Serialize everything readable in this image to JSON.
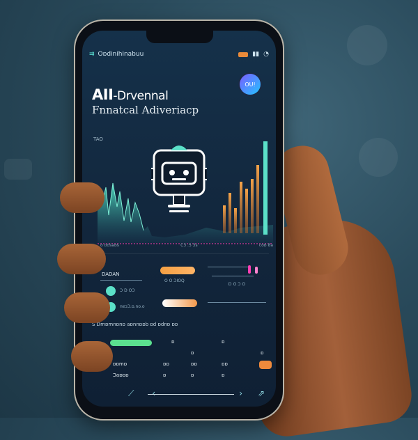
{
  "status_bar": {
    "app_name": "Oɒdinihinabuu",
    "icons": [
      "battery-icon",
      "signal-icon",
      "wifi-icon"
    ]
  },
  "avatar": {
    "label": "OU!"
  },
  "hero": {
    "title_bold": "AII",
    "title_rest": "-Drvennal",
    "subtitle": "Fnnatcal Adiveriacp"
  },
  "chart": {
    "top_label": "TAO",
    "axis_labels": [
      "o ɒdsaɒs",
      "C3 .5 3s",
      "coɒ 8a"
    ]
  },
  "controls": {
    "label_1": "DADAN",
    "slider_1_caption": "O O ƆIOQ",
    "toggle_1_caption": "Ɔ D OƆ",
    "toggle_2_caption": "nɐɔƆ.ɒ.no.o",
    "bar_1_caption": "Ɒ O Ɔ O"
  },
  "table": {
    "header": "S  Ɒmɒmnɒnɒ  aɒnnɒɒb  ɒd  ɒdnɒ  ɒɒ",
    "rows": [
      {
        "c1": "",
        "c2": "ɒ",
        "c3": "ɒ",
        "c4": "ɒ",
        "c5": ""
      },
      {
        "c1": "ɒɒb",
        "c2": "ɒ",
        "c3": "ɒ",
        "c4": "ɒ",
        "c5": "ɒ"
      },
      {
        "c1": "ɒɒmɒ",
        "c2": "ɒɒ",
        "c3": "ɒɒ",
        "c4": "ɒɒ",
        "c5": ""
      },
      {
        "c1": "Ɔaɒɒɒ",
        "c2": "ɒ",
        "c3": "ɒ",
        "c4": "ɒ",
        "c5": ""
      }
    ]
  },
  "colors": {
    "accent_teal": "#55d3c8",
    "accent_orange": "#f5a043",
    "accent_pink": "#ff3fb4",
    "accent_green": "#5be08f",
    "screen_bg": "#15314a"
  }
}
